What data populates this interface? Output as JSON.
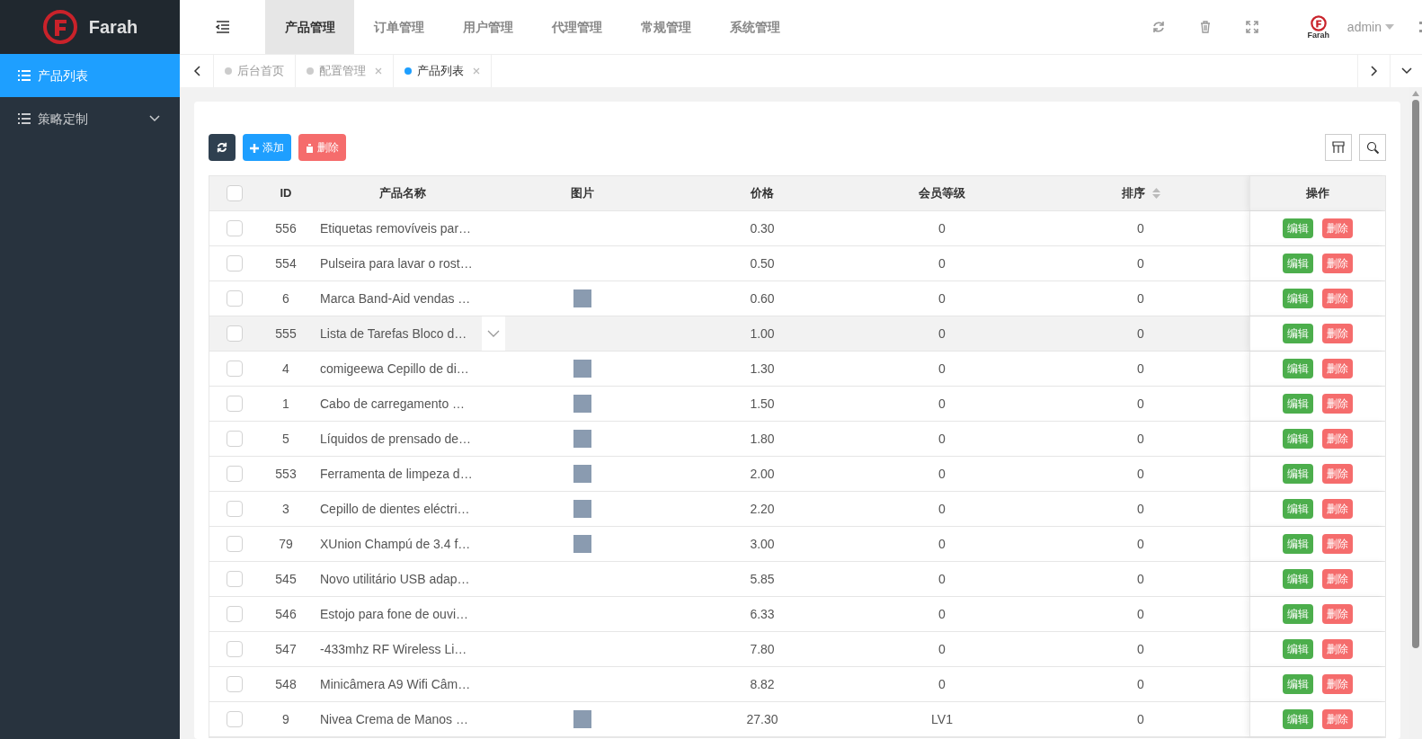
{
  "brand": {
    "name": "Farah"
  },
  "sidebar": {
    "items": [
      {
        "label": "产品列表",
        "selected": true,
        "expandable": false
      },
      {
        "label": "策略定制",
        "selected": false,
        "expandable": true
      }
    ]
  },
  "top_nav": {
    "items": [
      {
        "label": "产品管理",
        "selected": true
      },
      {
        "label": "订单管理",
        "selected": false
      },
      {
        "label": "用户管理",
        "selected": false
      },
      {
        "label": "代理管理",
        "selected": false
      },
      {
        "label": "常规管理",
        "selected": false
      },
      {
        "label": "系统管理",
        "selected": false
      }
    ],
    "user": "admin",
    "logo_caption": "Farah"
  },
  "page_tabs": [
    {
      "label": "后台首页",
      "selected": false,
      "closable": false
    },
    {
      "label": "配置管理",
      "selected": false,
      "closable": true
    },
    {
      "label": "产品列表",
      "selected": true,
      "closable": true
    }
  ],
  "toolbar": {
    "add": "添加",
    "delete": "删除"
  },
  "table": {
    "select_all_checked": false,
    "columns": [
      "ID",
      "产品名称",
      "图片",
      "价格",
      "会员等级",
      "排序",
      "操作"
    ],
    "rows": [
      {
        "id": "556",
        "name": "Etiquetas removíveis par…",
        "image": false,
        "price": "0.30",
        "level": "0",
        "sort": "0",
        "checked": false,
        "highlighted": false,
        "actions": [
          "编辑",
          "删除"
        ]
      },
      {
        "id": "554",
        "name": "Pulseira para lavar o rost…",
        "image": false,
        "price": "0.50",
        "level": "0",
        "sort": "0",
        "checked": false,
        "highlighted": false,
        "actions": [
          "编辑",
          "删除"
        ]
      },
      {
        "id": "6",
        "name": "Marca Band-Aid vendas …",
        "image": true,
        "price": "0.60",
        "level": "0",
        "sort": "0",
        "checked": false,
        "highlighted": false,
        "actions": [
          "编辑",
          "删除"
        ]
      },
      {
        "id": "555",
        "name": "Lista de Tarefas Bloco d…",
        "image": false,
        "price": "1.00",
        "level": "0",
        "sort": "0",
        "checked": false,
        "highlighted": true,
        "actions": [
          "编辑",
          "删除"
        ]
      },
      {
        "id": "4",
        "name": "comigeewa Cepillo de di…",
        "image": true,
        "price": "1.30",
        "level": "0",
        "sort": "0",
        "checked": false,
        "highlighted": false,
        "actions": [
          "编辑",
          "删除"
        ]
      },
      {
        "id": "1",
        "name": "Cabo de carregamento …",
        "image": true,
        "price": "1.50",
        "level": "0",
        "sort": "0",
        "checked": false,
        "highlighted": false,
        "actions": [
          "编辑",
          "删除"
        ]
      },
      {
        "id": "5",
        "name": "Líquidos de prensado de…",
        "image": true,
        "price": "1.80",
        "level": "0",
        "sort": "0",
        "checked": false,
        "highlighted": false,
        "actions": [
          "编辑",
          "删除"
        ]
      },
      {
        "id": "553",
        "name": "Ferramenta de limpeza d…",
        "image": true,
        "price": "2.00",
        "level": "0",
        "sort": "0",
        "checked": false,
        "highlighted": false,
        "actions": [
          "编辑",
          "删除"
        ]
      },
      {
        "id": "3",
        "name": "Cepillo de dientes eléctri…",
        "image": true,
        "price": "2.20",
        "level": "0",
        "sort": "0",
        "checked": false,
        "highlighted": false,
        "actions": [
          "编辑",
          "删除"
        ]
      },
      {
        "id": "79",
        "name": "XUnion Champú de 3.4 f…",
        "image": true,
        "price": "3.00",
        "level": "0",
        "sort": "0",
        "checked": false,
        "highlighted": false,
        "actions": [
          "编辑",
          "删除"
        ]
      },
      {
        "id": "545",
        "name": "Novo utilitário USB adap…",
        "image": false,
        "price": "5.85",
        "level": "0",
        "sort": "0",
        "checked": false,
        "highlighted": false,
        "actions": [
          "编辑",
          "删除"
        ]
      },
      {
        "id": "546",
        "name": "Estojo para fone de ouvi…",
        "image": false,
        "price": "6.33",
        "level": "0",
        "sort": "0",
        "checked": false,
        "highlighted": false,
        "actions": [
          "编辑",
          "删除"
        ]
      },
      {
        "id": "547",
        "name": "-433mhz RF Wireless Li…",
        "image": false,
        "price": "7.80",
        "level": "0",
        "sort": "0",
        "checked": false,
        "highlighted": false,
        "actions": [
          "编辑",
          "删除"
        ]
      },
      {
        "id": "548",
        "name": "Minicâmera A9 Wifi Câm…",
        "image": false,
        "price": "8.82",
        "level": "0",
        "sort": "0",
        "checked": false,
        "highlighted": false,
        "actions": [
          "编辑",
          "删除"
        ]
      },
      {
        "id": "9",
        "name": "Nivea Crema de Manos …",
        "image": true,
        "price": "27.30",
        "level": "LV1",
        "sort": "0",
        "checked": false,
        "highlighted": false,
        "actions": [
          "编辑",
          "删除"
        ]
      }
    ]
  }
}
